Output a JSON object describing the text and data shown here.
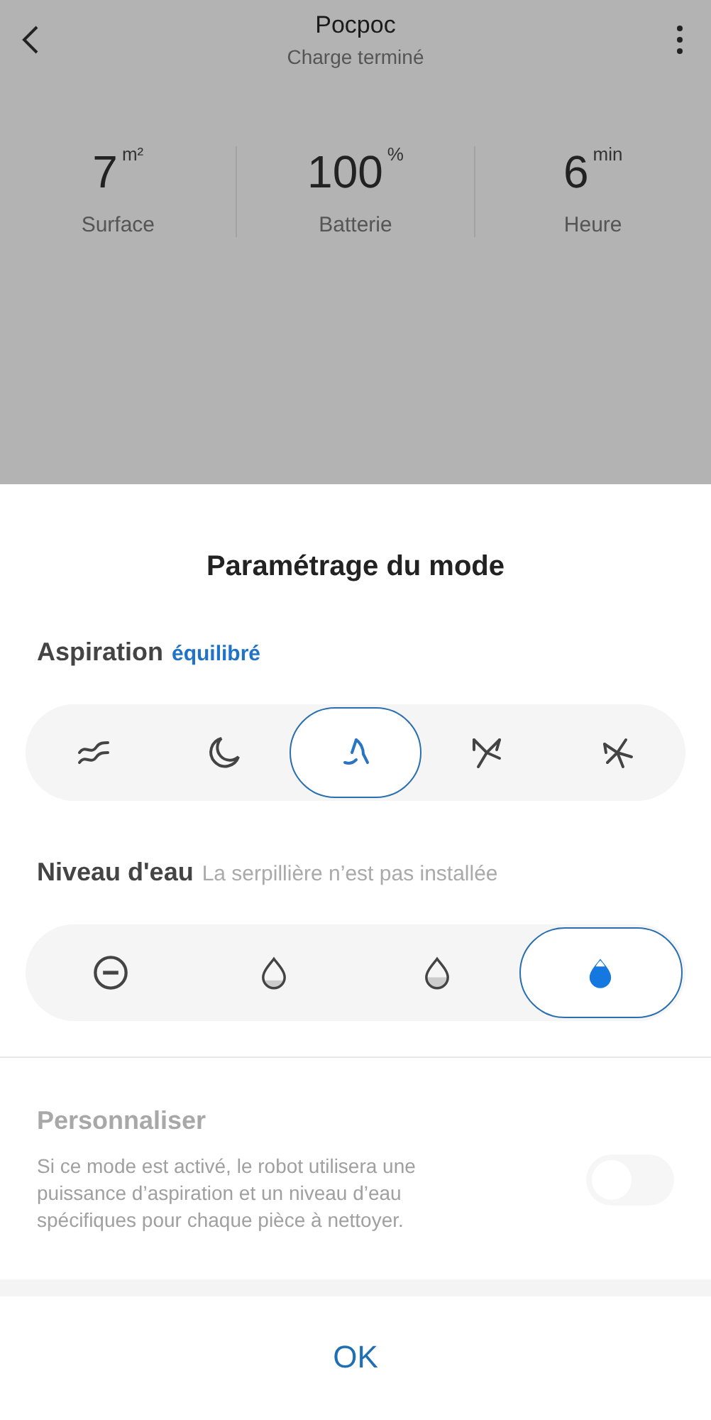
{
  "header": {
    "title": "Pocpoc",
    "subtitle": "Charge terminé"
  },
  "stats": [
    {
      "value": "7",
      "unit": "m²",
      "label": "Surface"
    },
    {
      "value": "100",
      "unit": "%",
      "label": "Batterie"
    },
    {
      "value": "6",
      "unit": "min",
      "label": "Heure"
    }
  ],
  "sheet": {
    "title": "Paramétrage du mode",
    "suction": {
      "label": "Aspiration",
      "value": "équilibré",
      "options": [
        {
          "kind": "quiet",
          "selected": false
        },
        {
          "kind": "night",
          "selected": false
        },
        {
          "kind": "balanced",
          "selected": true
        },
        {
          "kind": "turbo",
          "selected": false
        },
        {
          "kind": "max",
          "selected": false
        }
      ]
    },
    "water": {
      "label": "Niveau d'eau",
      "note": "La serpillière n’est pas installée",
      "options": [
        {
          "kind": "off",
          "selected": false
        },
        {
          "kind": "low",
          "selected": false
        },
        {
          "kind": "medium",
          "selected": false
        },
        {
          "kind": "high",
          "selected": true
        }
      ]
    },
    "customize": {
      "title": "Personnaliser",
      "description": "Si ce mode est activé, le robot utilisera une puissance d’aspiration et un niveau d’eau spécifiques pour chaque pièce à nettoyer.",
      "disabled": true,
      "on": false
    },
    "button": "OK"
  }
}
